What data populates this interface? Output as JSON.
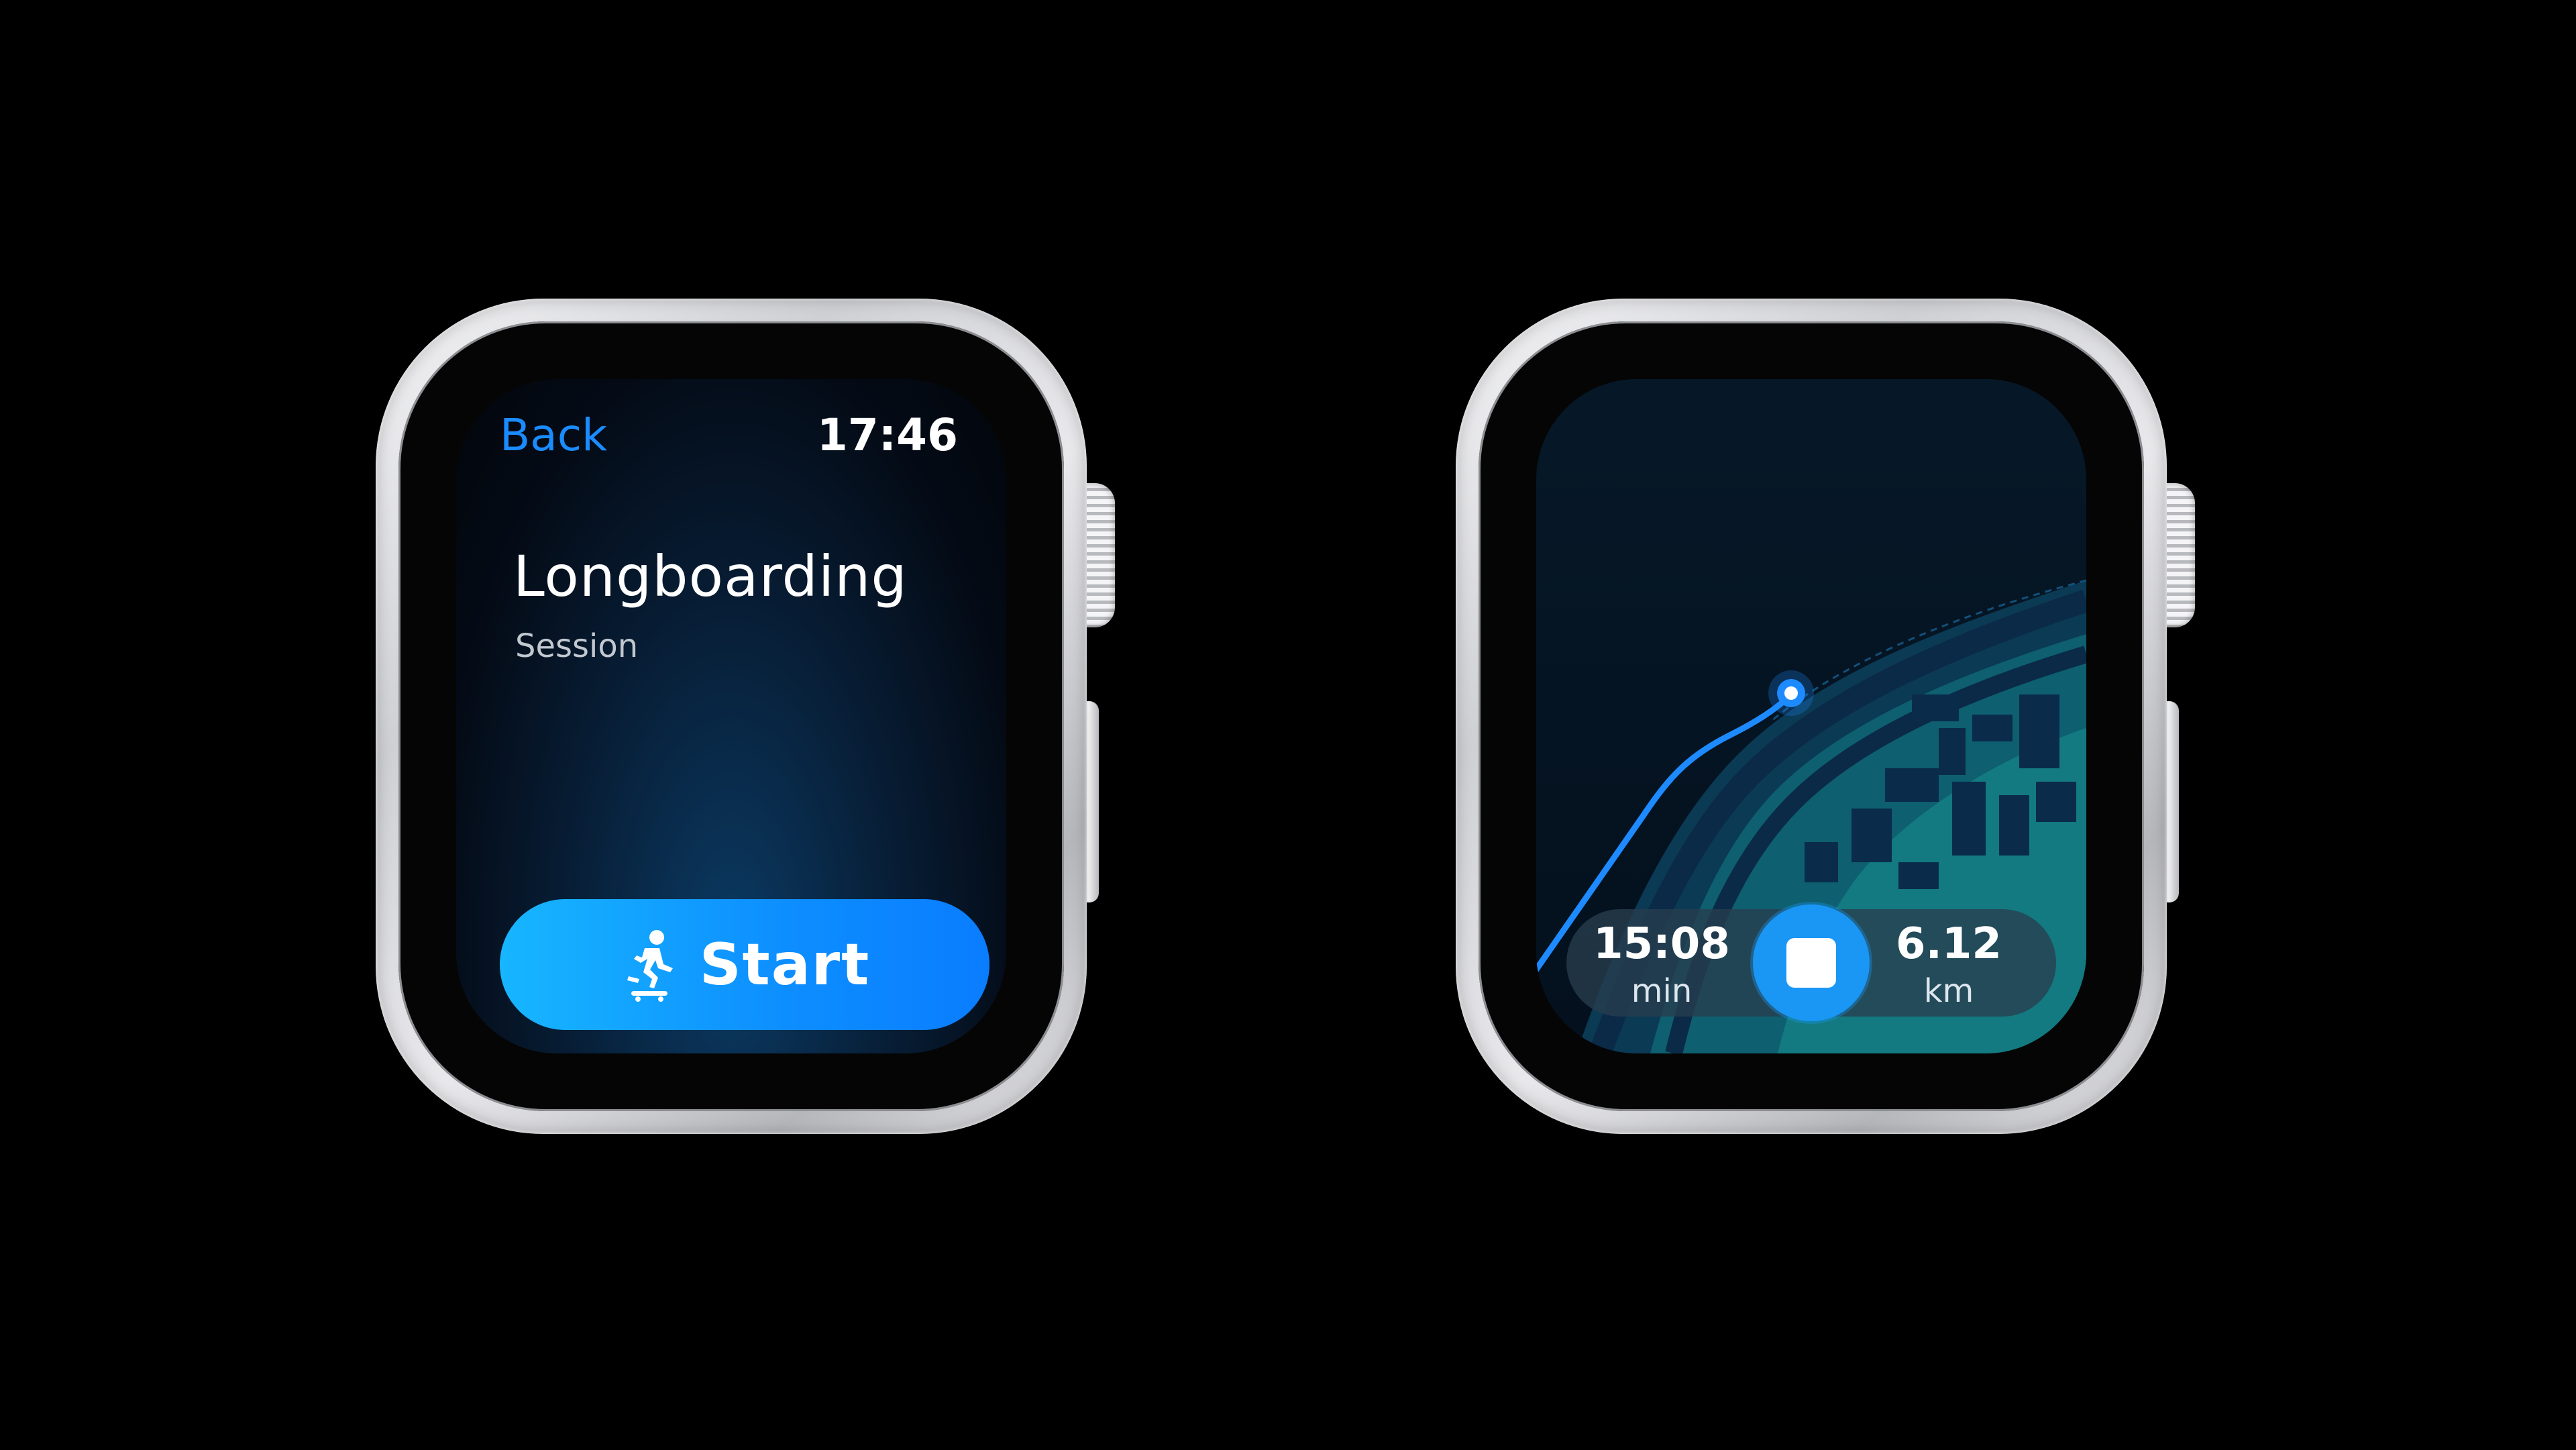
{
  "setup_screen": {
    "back_label": "Back",
    "time": "17:46",
    "activity_title": "Longboarding",
    "activity_subtitle": "Session",
    "start_label": "Start",
    "start_icon": "skateboarder-icon",
    "accent_color": "#1a8cff"
  },
  "workout_screen": {
    "elapsed_value": "15:08",
    "elapsed_unit": "min",
    "distance_value": "6.12",
    "distance_unit": "km",
    "stop_icon": "stop-icon",
    "route_color": "#1d8bff",
    "map_background": "#041324"
  }
}
